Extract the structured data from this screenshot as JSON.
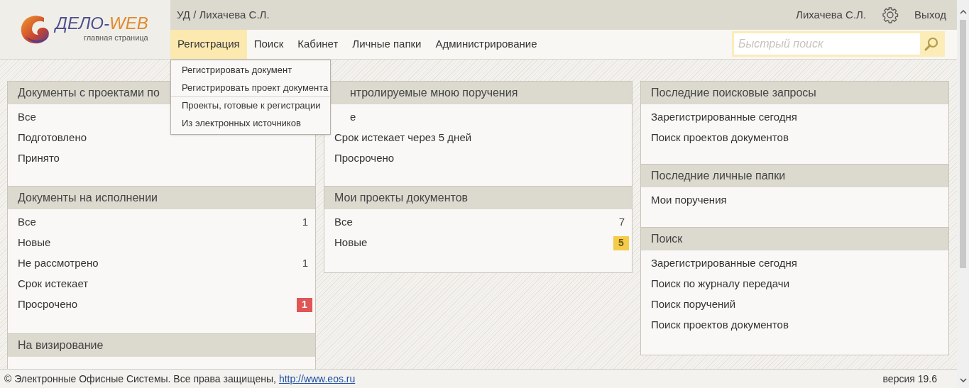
{
  "logo": {
    "name": "ДЕЛО-",
    "name_accent": "WEB",
    "subtitle": "главная страница"
  },
  "header": {
    "breadcrumb": "УД / Лихачева С.Л.",
    "user": "Лихачева С.Л.",
    "logout": "Выход"
  },
  "nav": [
    {
      "label": "Регистрация",
      "selected": true
    },
    {
      "label": "Поиск",
      "selected": false
    },
    {
      "label": "Кабинет",
      "selected": false
    },
    {
      "label": "Личные папки",
      "selected": false
    },
    {
      "label": "Администрирование",
      "selected": false
    }
  ],
  "search": {
    "placeholder": "Быстрый поиск"
  },
  "menu": [
    {
      "label": "Регистрировать документ",
      "separator_after": false
    },
    {
      "label": "Регистрировать проект документа",
      "separator_after": true
    },
    {
      "label": "Проекты, готовые к регистрации",
      "separator_after": false
    },
    {
      "label": "Из электронных источников",
      "separator_after": false
    }
  ],
  "columns": [
    [
      {
        "title": "Документы с проектами по",
        "items": [
          {
            "label": "Все"
          },
          {
            "label": "Подготовлено"
          },
          {
            "label": "Принято"
          }
        ]
      },
      {
        "title": "Документы на исполнении",
        "items": [
          {
            "label": "Все",
            "count": "1"
          },
          {
            "label": "Новые"
          },
          {
            "label": "Не рассмотрено",
            "count": "1"
          },
          {
            "label": "Срок истекает"
          },
          {
            "label": "Просрочено",
            "count": "1",
            "color": "#e05555"
          }
        ]
      },
      {
        "title": "На визирование"
      }
    ],
    [
      {
        "title": "нтролируемые мною поручения",
        "items": [
          {
            "label": "е"
          },
          {
            "label": "Срок истекает через 5 дней"
          },
          {
            "label": "Просрочено"
          }
        ]
      },
      {
        "title": "Мои проекты документов",
        "items": [
          {
            "label": "Все",
            "count": "7"
          },
          {
            "label": "Новые",
            "count": "5",
            "color": "#f5cc4a"
          }
        ]
      }
    ],
    [
      {
        "title": "Последние поисковые запросы",
        "items": [
          {
            "label": "Зарегистрированные сегодня"
          },
          {
            "label": "Поиск проектов документов"
          }
        ]
      },
      {
        "title": "Последние личные папки",
        "items": [
          {
            "label": "Мои поручения"
          }
        ]
      },
      {
        "title": "Поиск",
        "items": [
          {
            "label": "Зарегистрированные сегодня"
          },
          {
            "label": "Поиск по журналу передачи"
          },
          {
            "label": "Поиск поручений"
          },
          {
            "label": "Поиск проектов документов"
          }
        ]
      }
    ]
  ],
  "footer": {
    "copyright": "© Электронные Офисные Системы. Все права защищены,",
    "link": "http://www.eos.ru",
    "version": "версия 19.6"
  }
}
